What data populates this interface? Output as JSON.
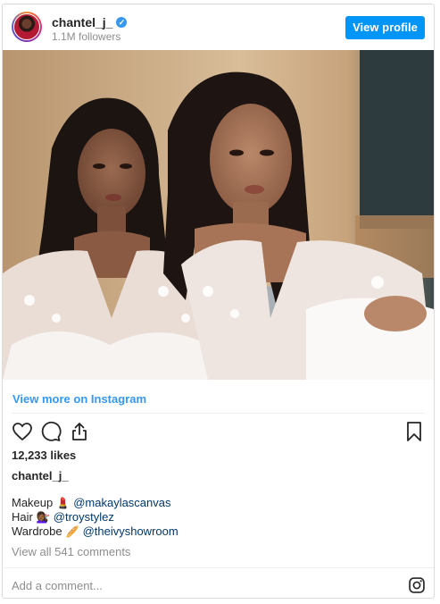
{
  "header": {
    "username": "chantel_j_",
    "verified_icon": "verified-check-icon",
    "followers": "1.1M followers",
    "view_profile_label": "View profile"
  },
  "photo": {
    "description_icon": "post-photo"
  },
  "view_more_label": "View more on Instagram",
  "actions": {
    "like_icon": "heart-icon",
    "comment_icon": "comment-icon",
    "share_icon": "share-icon",
    "save_icon": "bookmark-icon"
  },
  "likes": "12,233 likes",
  "post_username": "chantel_j_",
  "caption": [
    {
      "role": "Makeup",
      "emoji": "💄",
      "mention": "@makaylascanvas"
    },
    {
      "role": "Hair",
      "emoji": "💇🏾‍♀️",
      "mention": "@troystylez"
    },
    {
      "role": "Wardrobe",
      "emoji": "🥖",
      "mention": "@theivyshowroom"
    }
  ],
  "view_comments": "View all 541 comments",
  "add_comment_placeholder": "Add a comment...",
  "instagram_icon": "instagram-logo-icon",
  "colors": {
    "accent": "#0095f6",
    "link": "#3897f0",
    "mention": "#00376b",
    "muted": "#8e8e8e",
    "text": "#262626"
  }
}
